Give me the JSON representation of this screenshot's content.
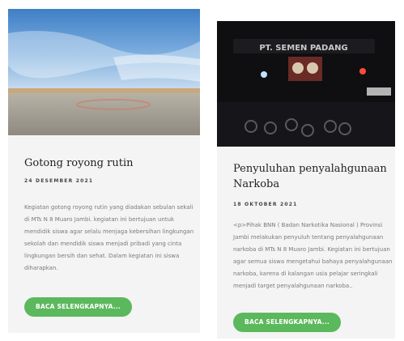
{
  "posts": [
    {
      "title": "Gotong royong rutin",
      "date": "24 DESEMBER 2021",
      "excerpt": "Kegiatan gotong royong rutin yang diadakan sebulan sekali di MTs N 8 Muaro Jambi. kegiatan ini bertujuan untuk mendidik siswa agar selalu menjaga kebersihan lingkungan sekolah dan mendidik siswa menjadi pribadi yang cinta lingkungan bersih dan sehat. Dalam kegiatan ini siswa diharapkan.",
      "button_label": "BACA SELENGKAPNYA..."
    },
    {
      "title": "Penyuluhan penyalahgunaan Narkoba",
      "date": "18 OKTOBER 2021",
      "excerpt": "<p>Pihak BNN ( Badan Narkotika Nasional ) Provinsi Jambi melakukan penyuluh tentang penyalahgunaan narkoba di MTs N 8 Muaro Jambi. Kegiatan ini bertujuan agar semua siswa mengetahui bahaya penyalahgunaan narkoba, karena di kalangan usia pelajar seringkali menjadi target penyalahgunaan narkoba..",
      "button_label": "BACA SELENGKAPNYA...",
      "image_sign_text": "PT. SEMEN PADANG"
    }
  ],
  "colors": {
    "button": "#5cb85c",
    "card_background": "#f4f4f4",
    "title_text": "#222222",
    "excerpt_text": "#7a7a7a"
  }
}
